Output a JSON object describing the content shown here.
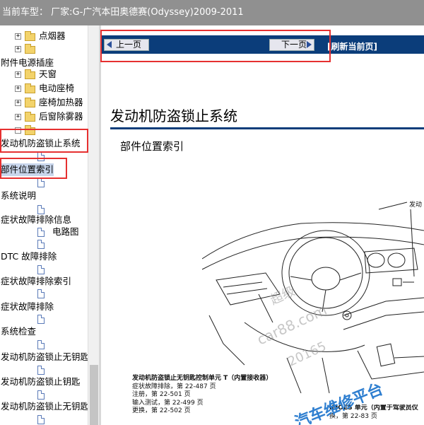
{
  "header": {
    "title": "当前车型： 厂家:G-广汽本田奥德赛(Odyssey)2009-2011"
  },
  "tree": {
    "items": [
      {
        "label": "点烟器",
        "type": "folder",
        "expander": "+"
      },
      {
        "label": "",
        "type": "folder",
        "expander": "+"
      },
      {
        "label": "附件电源插座",
        "type": "text"
      },
      {
        "label": "天窗",
        "type": "folder",
        "expander": "+"
      },
      {
        "label": "电动座椅",
        "type": "folder",
        "expander": "+"
      },
      {
        "label": "座椅加热器",
        "type": "folder",
        "expander": "+"
      },
      {
        "label": "后窗除雾器",
        "type": "folder",
        "expander": "+"
      },
      {
        "label": "",
        "type": "folder",
        "expander": "−"
      },
      {
        "label": "发动机防盗锁止系统",
        "type": "text"
      },
      {
        "label": "",
        "type": "doc"
      },
      {
        "label": "部件位置索引",
        "type": "text",
        "selected": true
      },
      {
        "label": "",
        "type": "doc"
      },
      {
        "label": "系统说明",
        "type": "text"
      },
      {
        "label": "",
        "type": "doc"
      },
      {
        "label": "症状故障排除信息",
        "type": "text"
      },
      {
        "label": "电路图",
        "type": "doc"
      },
      {
        "label": "",
        "type": "doc"
      },
      {
        "label": "DTC 故障排除",
        "type": "text"
      },
      {
        "label": "",
        "type": "doc"
      },
      {
        "label": "症状故障排除索引",
        "type": "text"
      },
      {
        "label": "",
        "type": "doc"
      },
      {
        "label": "症状故障排除",
        "type": "text"
      },
      {
        "label": "",
        "type": "doc"
      },
      {
        "label": "系统检查",
        "type": "text"
      },
      {
        "label": "",
        "type": "doc"
      },
      {
        "label": "发动机防盗锁止无钥匙",
        "type": "text"
      },
      {
        "label": "",
        "type": "doc"
      },
      {
        "label": "发动机防盗锁止钥匙",
        "type": "text"
      },
      {
        "label": "",
        "type": "doc"
      },
      {
        "label": "发动机防盗锁止无钥匙",
        "type": "text"
      },
      {
        "label": "",
        "type": "doc"
      }
    ]
  },
  "nav": {
    "prev_label": "上一页",
    "next_label": "下一页",
    "refresh_label": "[刷新当前页]"
  },
  "doc": {
    "title": "发动机防盗锁止系统",
    "subtitle": "部件位置索引",
    "callout_top": "发动",
    "caption_left": {
      "heading": "发动机防盗锁止无钥匙控制单元 T（内置接收器）",
      "lines": [
        "症状故障排除，第 22-487 页",
        "注册，第 22-501 页",
        "输入测试，第 22-499 页",
        "更换，第 22-502 页"
      ]
    },
    "caption_right": {
      "heading": "IMOES 单元（内置于驾驶员仪",
      "line": "换，第 22-83 页"
    },
    "watermarks": [
      "超级",
      "car88.com",
      "20165",
      "汽车维修平台"
    ]
  },
  "colors": {
    "nav_bar": "#0b3d7a",
    "header_bg": "#909090",
    "annotation": "#e63030",
    "watermark_blue": "#2f7fd0"
  },
  "icons": {
    "folder": "folder-icon",
    "doc": "document-icon",
    "prev": "arrow-left-icon",
    "next": "arrow-right-icon"
  }
}
